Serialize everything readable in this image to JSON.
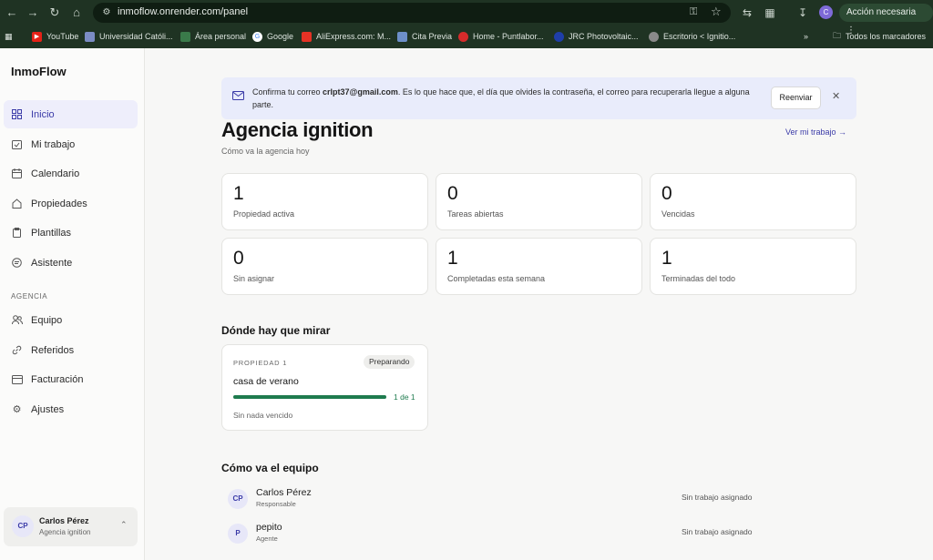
{
  "browser": {
    "url": "inmoflow.onrender.com/panel",
    "profile_initial": "C",
    "action_label": "Acción necesaria",
    "bookmarks": [
      {
        "label": "YouTube",
        "icon": "youtube-icon",
        "color": "#e62117"
      },
      {
        "label": "Universidad Católi...",
        "icon": "university-icon",
        "color": "#7b8cc4"
      },
      {
        "label": "Área personal",
        "icon": "leaf-icon",
        "color": "#3a7a4a"
      },
      {
        "label": "Google",
        "icon": "google-icon",
        "color": "#4285f4"
      },
      {
        "label": "AliExpress.com: M...",
        "icon": "aliexpress-icon",
        "color": "#e43225"
      },
      {
        "label": "Cita Previa",
        "icon": "calendar-icon",
        "color": "#6d8fc9"
      },
      {
        "label": "Home - Puntlabor...",
        "icon": "puntlabor-icon",
        "color": "#d62b2b"
      },
      {
        "label": "JRC Photovoltaic...",
        "icon": "eu-icon",
        "color": "#1f3ea8"
      },
      {
        "label": "Escritorio < Ignitio...",
        "icon": "wordpress-icon",
        "color": "#8a8a8a"
      }
    ],
    "all_bookmarks_label": "Todos los marcadores"
  },
  "sidebar": {
    "brand": "InmoFlow",
    "items": [
      {
        "label": "Inicio",
        "icon": "grid-icon",
        "active": true
      },
      {
        "label": "Mi trabajo",
        "icon": "checklist-icon",
        "active": false
      },
      {
        "label": "Calendario",
        "icon": "calendar-icon",
        "active": false
      },
      {
        "label": "Propiedades",
        "icon": "home-icon",
        "active": false
      },
      {
        "label": "Plantillas",
        "icon": "clipboard-icon",
        "active": false
      },
      {
        "label": "Asistente",
        "icon": "chat-icon",
        "active": false
      }
    ],
    "section_label": "AGENCIA",
    "agency_items": [
      {
        "label": "Equipo",
        "icon": "users-icon"
      },
      {
        "label": "Referidos",
        "icon": "link-icon"
      },
      {
        "label": "Facturación",
        "icon": "card-icon"
      },
      {
        "label": "Ajustes",
        "icon": "gear-icon"
      }
    ],
    "user": {
      "initials": "CP",
      "name": "Carlos Pérez",
      "agency": "Agencia ignition"
    }
  },
  "banner": {
    "text_before": "Confirma tu correo ",
    "email": "crlpt37@gmail.com",
    "text_after": ". Es lo que hace que, el día que olvides la contraseña, el correo para recuperarla llegue a alguna parte.",
    "resend_label": "Reenviar"
  },
  "header": {
    "title": "Agencia ignition",
    "subtitle": "Cómo va la agencia hoy",
    "link": "Ver mi trabajo →"
  },
  "stats": [
    {
      "value": "1",
      "label": "Propiedad activa"
    },
    {
      "value": "0",
      "label": "Tareas abiertas"
    },
    {
      "value": "0",
      "label": "Vencidas"
    },
    {
      "value": "0",
      "label": "Sin asignar"
    },
    {
      "value": "1",
      "label": "Completadas esta semana"
    },
    {
      "value": "1",
      "label": "Terminadas del todo"
    }
  ],
  "watch": {
    "heading": "Dónde hay que mirar",
    "card": {
      "kicker": "PROPIEDAD 1",
      "status": "Preparando",
      "name": "casa de verano",
      "progress": 1.0,
      "count": "1 de 1",
      "due": "Sin nada vencido"
    }
  },
  "team": {
    "heading": "Cómo va el equipo",
    "members": [
      {
        "initials": "CP",
        "name": "Carlos Pérez",
        "role": "Responsable",
        "status": "Sin trabajo asignado"
      },
      {
        "initials": "P",
        "name": "pepito",
        "role": "Agente",
        "status": "Sin trabajo asignado"
      }
    ]
  }
}
